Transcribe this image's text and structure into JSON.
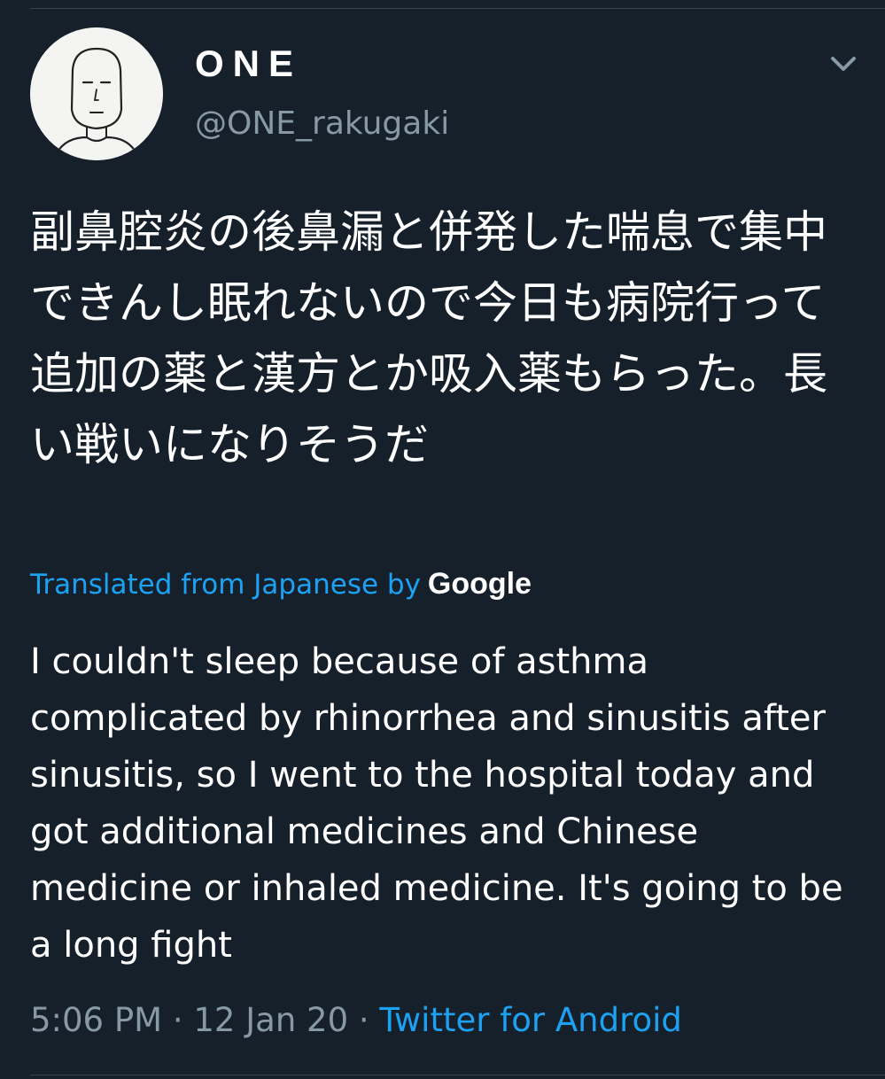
{
  "author": {
    "display_name": "ONE",
    "handle": "@ONE_rakugaki",
    "avatar": "avatar-doodle-face",
    "menu_icon": "chevron-down-icon"
  },
  "tweet": {
    "text": "副鼻腔炎の後鼻漏と併発した喘息で集中できんし眠れないので今日も病院行って追加の薬と漢方とか吸入薬もらった。長い戦いになりそうだ"
  },
  "translation": {
    "label": "Translated from Japanese by",
    "provider": "Google",
    "text": "I couldn't sleep because of asthma complicated by rhinorrhea and sinusitis after sinusitis, so I went to the hospital today and got additional medicines and Chinese medicine or inhaled medicine. It's going to be a long fight"
  },
  "meta": {
    "time": "5:06 PM",
    "separator": " · ",
    "date": "12 Jan 20",
    "source": "Twitter for Android"
  },
  "colors": {
    "background": "#15202b",
    "text_primary": "#ffffff",
    "text_secondary": "#8899a6",
    "accent": "#1da1f2",
    "divider": "#38444d"
  }
}
